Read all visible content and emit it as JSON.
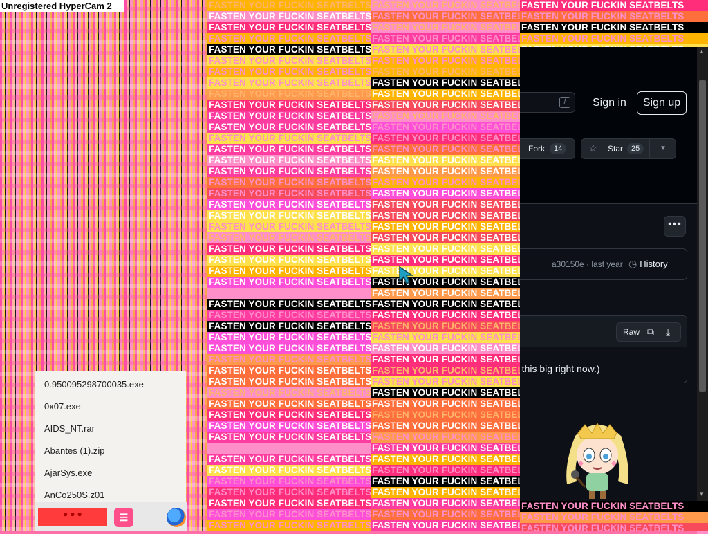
{
  "recording_label": "Unregistered HyperCam 2",
  "banner_text": "FASTEN YOUR FUCKIN SEATBELTS",
  "github": {
    "search_shortcut": "/",
    "sign_in": "Sign in",
    "sign_up": "Sign up",
    "fork_label": "Fork",
    "fork_count": "14",
    "star_label": "Star",
    "star_count": "25",
    "more_label": "•••",
    "commit_info": "a30150e · last year",
    "history_label": "History",
    "raw_label": "Raw",
    "file_message": "e this big right now.)"
  },
  "file_list": [
    "0.950095298700035.exe",
    "0x07.exe",
    "AIDS_NT.rar",
    "Abantes (1).zip",
    "AjarSys.exe",
    "AnCo250S.z01"
  ],
  "taskbar": {
    "notes_icon_letter": "☰"
  },
  "colors": {
    "banner_palette": [
      "#ff2d7a",
      "#ff3da0",
      "#ff8fc9",
      "#ff6f3c",
      "#ffb400",
      "#ff9a4d",
      "#ffe14d",
      "#000000",
      "#ff4fd8",
      "#f74b5b"
    ]
  }
}
